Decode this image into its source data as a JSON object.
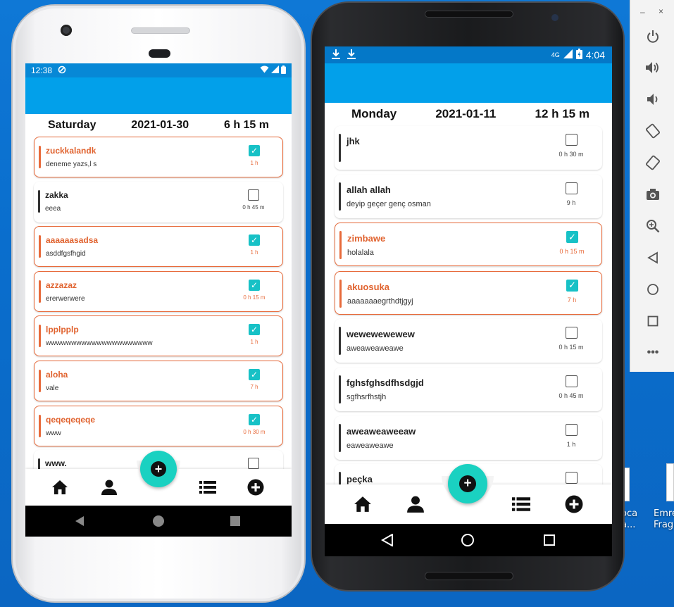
{
  "phone1": {
    "status": {
      "time": "12:38"
    },
    "header": {
      "day": "Saturday",
      "date": "2021-01-30",
      "total": "6 h 15 m"
    },
    "tasks": [
      {
        "title": "zuckkalandk",
        "desc": "deneme yazs,l s",
        "duration": "1 h",
        "done": true
      },
      {
        "title": "zakka",
        "desc": "eeea",
        "duration": "0 h 45 m",
        "done": false
      },
      {
        "title": "aaaaaasadsa",
        "desc": "asddfgsfhgid",
        "duration": "1 h",
        "done": true
      },
      {
        "title": "azzazaz",
        "desc": "ererwerwere",
        "duration": "0 h 15 m",
        "done": true
      },
      {
        "title": "lpplpplp",
        "desc": "wwwwwwwwwwwwwwwwwwwww",
        "duration": "1 h",
        "done": true
      },
      {
        "title": "aloha",
        "desc": "vale",
        "duration": "7 h",
        "done": true
      },
      {
        "title": "qeqeqeqeqe",
        "desc": "www",
        "duration": "0 h 30 m",
        "done": true
      },
      {
        "title": "www.",
        "desc": "",
        "duration": "",
        "done": false
      }
    ]
  },
  "phone2": {
    "status": {
      "network": "4G",
      "time": "4:04"
    },
    "header": {
      "day": "Monday",
      "date": "2021-01-11",
      "total": "12 h 15 m"
    },
    "tasks": [
      {
        "title": "jhk",
        "desc": "",
        "duration": "0 h 30 m",
        "done": false
      },
      {
        "title": "allah allah",
        "desc": " deyip geçer genç osman",
        "duration": "9 h",
        "done": false
      },
      {
        "title": "zimbawe",
        "desc": "holalala",
        "duration": "0 h 15 m",
        "done": true
      },
      {
        "title": "akuosuka",
        "desc": "aaaaaaaegrthdtjgyj",
        "duration": "7 h",
        "done": true
      },
      {
        "title": "wewewewewew",
        "desc": "aweaweaweawe",
        "duration": "0 h 15 m",
        "done": false
      },
      {
        "title": "fghsfghsdfhsdgjd",
        "desc": "sgfhsrfhstjh",
        "duration": "0 h 45 m",
        "done": false
      },
      {
        "title": "aweaweaweeaw",
        "desc": "eaweaweawe",
        "duration": "1 h",
        "done": false
      },
      {
        "title": "peçka",
        "desc": "",
        "duration": "",
        "done": false
      }
    ]
  },
  "nav": {
    "icons": [
      "home-icon",
      "person-icon",
      "add-fab-icon",
      "list-icon",
      "add-circle-icon"
    ]
  },
  "desktop": {
    "label1": "oca",
    "label1b": "a...",
    "label2": "Emre",
    "label2b": "Fragr"
  },
  "colors": {
    "appbar": "#02a0ea",
    "statusbar": "#0788d6",
    "done_accent": "#e76a3a",
    "checkbox_checked": "#17c1c6",
    "fab": "#1ad1c1",
    "desktop_bg": "#0b6fd0"
  }
}
